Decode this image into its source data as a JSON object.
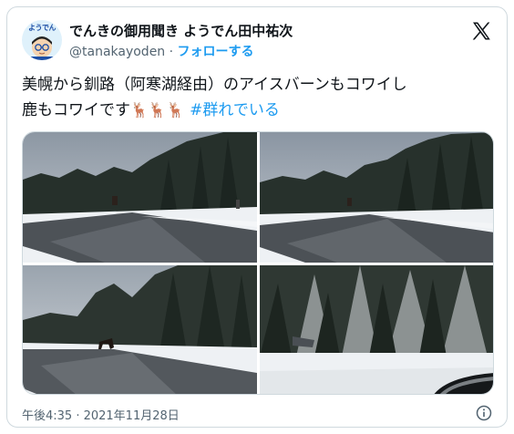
{
  "author": {
    "avatar_logo": "ようでん",
    "name": "でんきの御用聞き ようでん田中祐次",
    "handle": "@tanakayoden",
    "separator": " · ",
    "follow_label": "フォローする"
  },
  "tweet": {
    "line1": "美幌から釧路（阿寒湖経由）のアイスバーンもコワイし",
    "line2_text": "鹿もコワイです",
    "emojis": "🦌🦌🦌",
    "hashtag": "#群れでいる"
  },
  "media": {
    "photo_count": 4
  },
  "footer": {
    "timestamp": "午後4:35 · 2021年11月28日"
  },
  "colors": {
    "accent": "#1d9bf0",
    "text": "#0f1419",
    "muted": "#536471",
    "border": "#cfd9de"
  },
  "icons": {
    "brand": "x-logo-icon",
    "info": "info-icon"
  }
}
